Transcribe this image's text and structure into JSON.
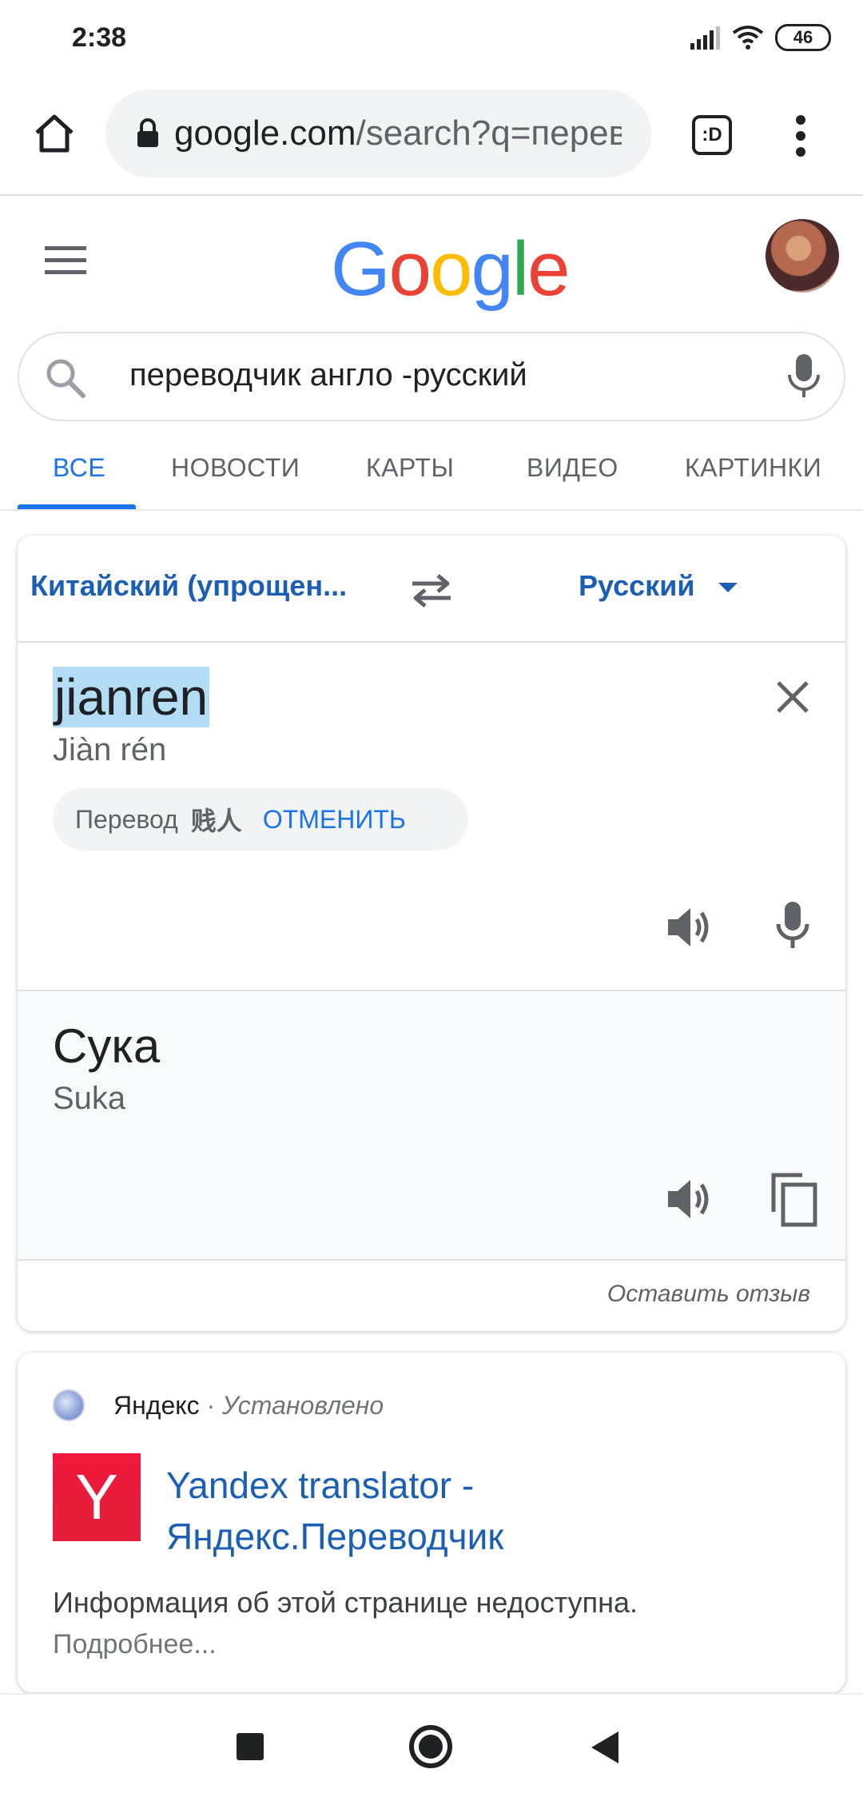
{
  "status_bar": {
    "time": "2:38",
    "battery": "46"
  },
  "browser": {
    "url_main": "google.com",
    "url_rest": "/search?q=перев",
    "tab_switcher_label": ":D"
  },
  "google": {
    "logo": [
      "G",
      "o",
      "o",
      "g",
      "l",
      "e"
    ]
  },
  "search": {
    "query": "переводчик англо -русский"
  },
  "tabs": [
    {
      "label": "ВСЕ",
      "active": true
    },
    {
      "label": "НОВОСТИ"
    },
    {
      "label": "КАРТЫ"
    },
    {
      "label": "ВИДЕО"
    },
    {
      "label": "КАРТИНКИ"
    }
  ],
  "translate": {
    "source_lang": "Китайский (упрощен...",
    "target_lang": "Русский",
    "source_text": "jianren",
    "source_translit": "Jiàn rén",
    "suggestion_label": "Перевод",
    "suggestion_text": "贱人",
    "suggestion_cancel": "ОТМЕНИТЬ",
    "target_text": "Сука",
    "target_translit": "Suka",
    "feedback": "Оставить отзыв"
  },
  "result": {
    "site": "Яндекс",
    "separator": " · ",
    "status": "Установлено",
    "logo_letter": "Y",
    "title": "Yandex translator - Яндекс.Переводчик",
    "snippet": "Информация об этой странице недоступна.",
    "more": "Подробнее..."
  },
  "colors": {
    "accent": "#1a73e8",
    "link": "#1a5fb4",
    "yandex_red": "#e31e3a",
    "google_blue": "#4285f4",
    "google_red": "#ea4335",
    "google_yellow": "#fbbc05",
    "google_green": "#34a853"
  }
}
